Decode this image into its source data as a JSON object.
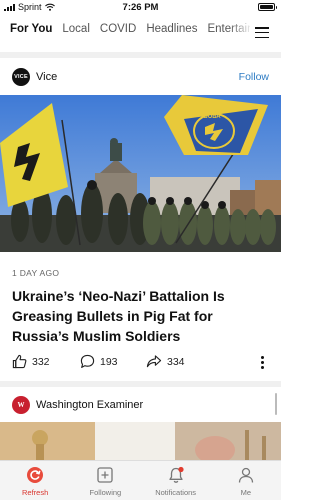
{
  "status_bar": {
    "carrier": "Sprint",
    "time": "7:26 PM"
  },
  "tabs": [
    {
      "label": "For You",
      "active": true
    },
    {
      "label": "Local",
      "active": false
    },
    {
      "label": "COVID",
      "active": false
    },
    {
      "label": "Headlines",
      "active": false
    },
    {
      "label": "Entertainm",
      "active": false
    }
  ],
  "article": {
    "publisher": "Vice",
    "publisher_logo_text": "VICE",
    "follow_label": "Follow",
    "age": "1 DAY AGO",
    "headline": "Ukraine’s ‘Neo-Nazi’ Battalion Is Greasing Bullets in Pig Fat for Russia’s Muslim Soldiers",
    "flag_text": "ВОВА",
    "likes": "332",
    "comments": "193",
    "shares": "334"
  },
  "next_article": {
    "publisher": "Washington Examiner",
    "publisher_logo_text": "W"
  },
  "bottom_nav": [
    {
      "label": "Refresh",
      "icon": "refresh-icon",
      "active": true
    },
    {
      "label": "Following",
      "icon": "following-icon",
      "active": false
    },
    {
      "label": "Notifications",
      "icon": "bell-icon",
      "active": false
    },
    {
      "label": "Me",
      "icon": "person-icon",
      "active": false
    }
  ],
  "colors": {
    "accent": "#2e7cc4",
    "active_nav": "#d9362f",
    "notification_dot": "#e23c2f"
  }
}
